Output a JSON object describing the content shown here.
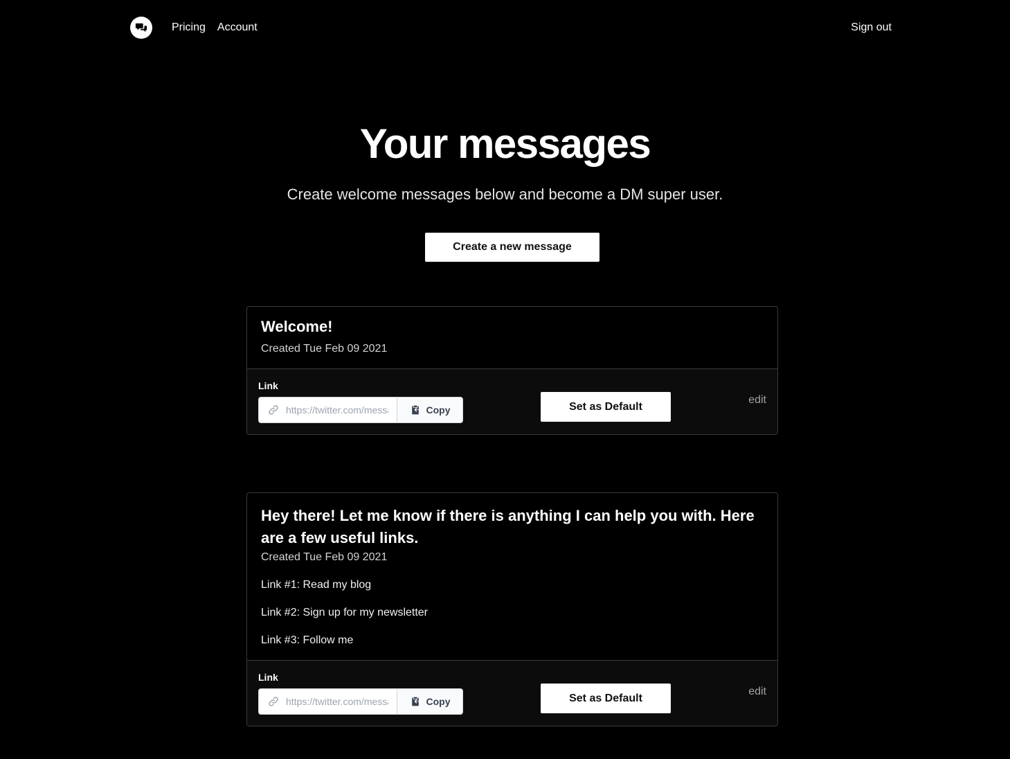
{
  "nav": {
    "pricing": "Pricing",
    "account": "Account",
    "sign_out": "Sign out"
  },
  "hero": {
    "title": "Your messages",
    "subtitle": "Create welcome messages below and become a DM super user."
  },
  "create_button": "Create a new message",
  "messages": [
    {
      "title": "Welcome!",
      "created": "Created Tue Feb 09 2021",
      "lines": [],
      "link_label": "Link",
      "link_placeholder": "https://twitter.com/messages/compose",
      "copy_label": "Copy",
      "default_label": "Set as Default",
      "edit_label": "edit"
    },
    {
      "title": "Hey there! Let me know if there is anything I can help you with. Here are a few useful links.",
      "created": "Created Tue Feb 09 2021",
      "lines": [
        "Link #1: Read my blog",
        "Link #2: Sign up for my newsletter",
        "Link #3: Follow me"
      ],
      "link_label": "Link",
      "link_placeholder": "https://twitter.com/messages/compose",
      "copy_label": "Copy",
      "default_label": "Set as Default",
      "edit_label": "edit"
    }
  ],
  "icons": {
    "logo": "chat-bubbles-icon",
    "link": "link-icon",
    "copy": "clipboard-icon"
  }
}
